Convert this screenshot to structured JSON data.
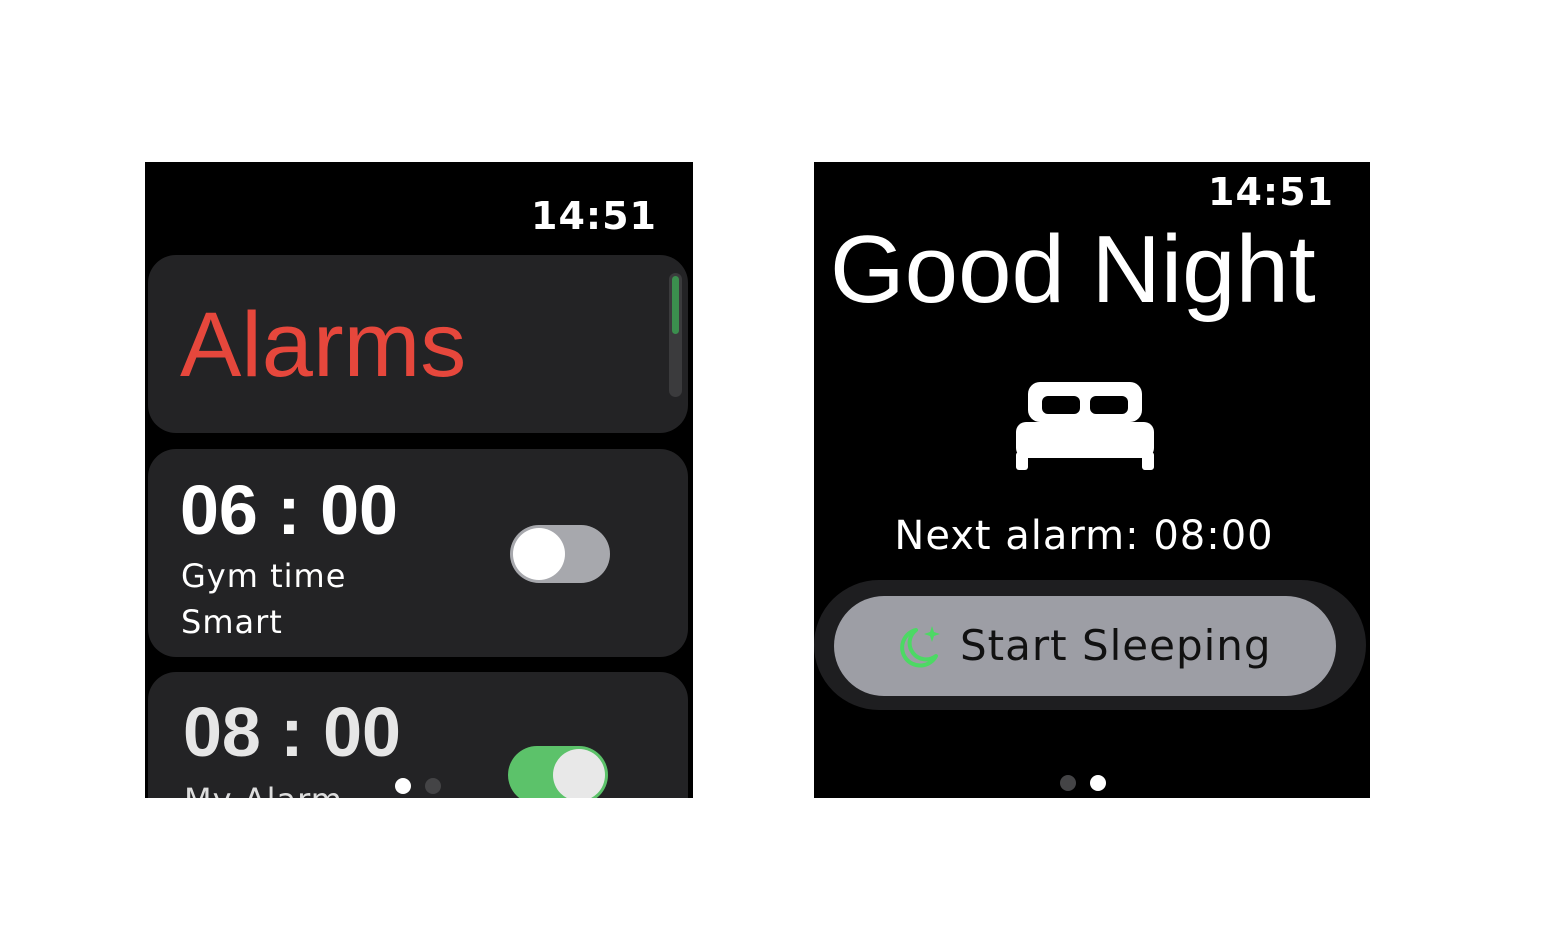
{
  "alarms_screen": {
    "clock": "14:51",
    "title": "Alarms",
    "alarms": [
      {
        "time": "06 : 00",
        "label": "Gym time",
        "sublabel": "Smart",
        "enabled": false
      },
      {
        "time": "08 : 00",
        "label": "My Alarm",
        "enabled": true
      }
    ],
    "page_indicator": {
      "total": 2,
      "current": 1
    }
  },
  "sleep_screen": {
    "clock": "14:51",
    "greeting": "Good Night",
    "icon": "bed-icon",
    "next_alarm": "Next alarm: 08:00",
    "start_button": {
      "label": "Start Sleeping",
      "icon": "moon-sparkle-icon"
    },
    "page_indicator": {
      "total": 2,
      "current": 2
    }
  },
  "colors": {
    "title_red": "#e6473c",
    "toggle_on": "#5cc26a",
    "toggle_off": "#a7a8ad",
    "card_bg": "#232325",
    "button_bg": "#9d9ea5",
    "moon_green": "#4cd964"
  }
}
